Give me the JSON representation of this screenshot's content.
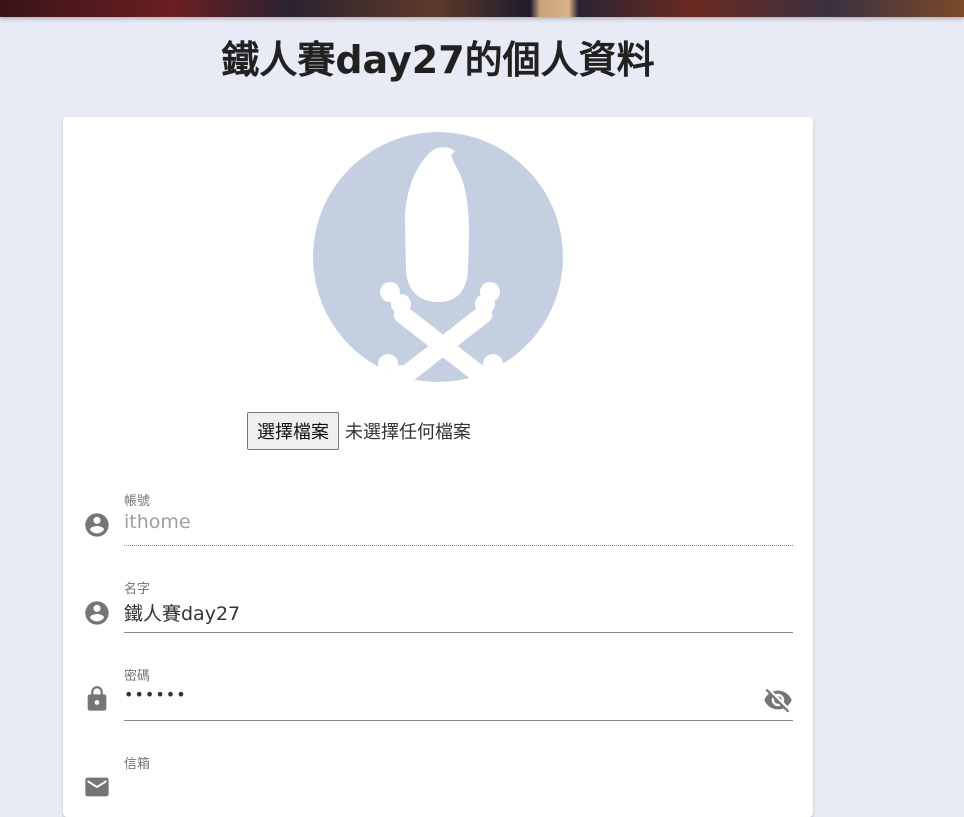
{
  "page": {
    "title": "鐵人賽day27的個人資料"
  },
  "profile": {
    "avatar_icon": "skull-crossbones-icon",
    "file_button_label": "選擇檔案",
    "file_status": "未選擇任何檔案"
  },
  "fields": {
    "account": {
      "label": "帳號",
      "value": "ithome",
      "icon": "account-circle-icon",
      "disabled": true
    },
    "name": {
      "label": "名字",
      "value": "鐵人賽day27",
      "icon": "account-circle-icon"
    },
    "password": {
      "label": "密碼",
      "value": "••••••",
      "icon": "lock-icon",
      "toggle_icon": "eye-off-icon"
    },
    "email": {
      "label": "信箱",
      "icon": "email-icon"
    }
  },
  "colors": {
    "background": "#e8eaf6",
    "avatar_bg": "#c5cfe2",
    "icon": "#757575"
  }
}
